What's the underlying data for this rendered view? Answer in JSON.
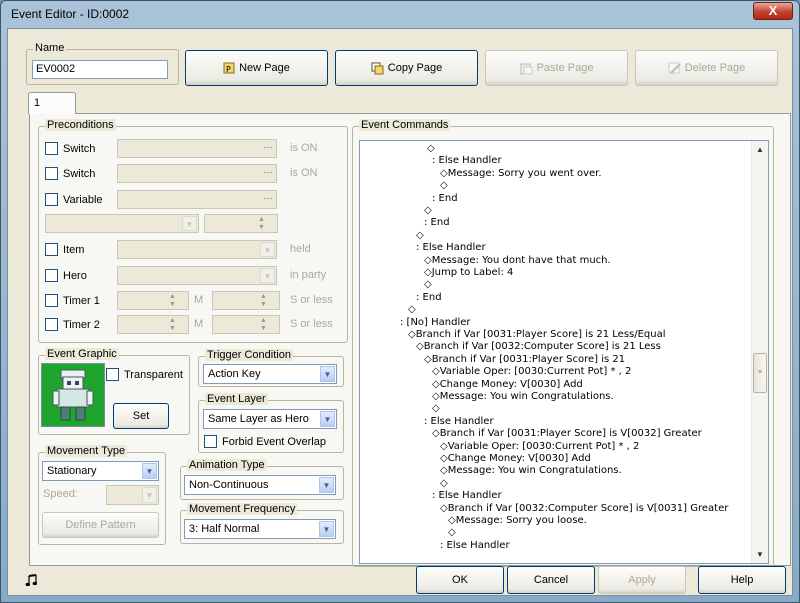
{
  "window": {
    "title": "Event Editor - ID:0002",
    "close_glyph": "X"
  },
  "name_group": {
    "label": "Name",
    "value": "EV0002"
  },
  "toolbar": {
    "new_page": "New Page",
    "copy_page": "Copy Page",
    "paste_page": "Paste Page",
    "delete_page": "Delete Page"
  },
  "tabs": [
    {
      "label": "1"
    }
  ],
  "preconditions": {
    "label": "Preconditions",
    "switch1": {
      "label": "Switch",
      "suffix": "is ON"
    },
    "switch2": {
      "label": "Switch",
      "suffix": "is ON"
    },
    "variable": {
      "label": "Variable"
    },
    "item": {
      "label": "Item",
      "suffix": "held"
    },
    "hero": {
      "label": "Hero",
      "suffix": "in party"
    },
    "timer1": {
      "label": "Timer 1",
      "unit": "M",
      "suffix": "S or less"
    },
    "timer2": {
      "label": "Timer 2",
      "unit": "M",
      "suffix": "S or less"
    }
  },
  "event_graphic": {
    "label": "Event Graphic",
    "transparent": "Transparent",
    "set": "Set"
  },
  "trigger": {
    "label": "Trigger Condition",
    "value": "Action Key"
  },
  "event_layer": {
    "label": "Event Layer",
    "value": "Same Layer as Hero",
    "forbid": "Forbid Event Overlap"
  },
  "movement_type": {
    "label": "Movement Type",
    "value": "Stationary",
    "speed": "Speed:",
    "define": "Define Pattern"
  },
  "animation": {
    "label": "Animation Type",
    "value": "Non-Continuous"
  },
  "frequency": {
    "label": "Movement Frequency",
    "value": "3: Half Normal"
  },
  "commands": {
    "label": "Event Commands",
    "lines": [
      "◇",
      ": Else Handler",
      "◇Message: Sorry you went over.",
      "◇",
      ": End",
      "◇",
      ": End",
      "◇",
      ": Else Handler",
      "◇Message: You dont have that much.",
      "◇Jump to Label: 4",
      "◇",
      ": End",
      "◇",
      ": [No] Handler",
      "◇Branch if Var [0031:Player Score] is 21 Less/Equal",
      "◇Branch if Var [0032:Computer Score] is 21 Less",
      "◇Branch if Var [0031:Player Score] is 21",
      "◇Variable Oper: [0030:Current Pot] * , 2",
      "◇Change Money: V[0030] Add",
      "◇Message: You win Congratulations.",
      "◇",
      ": Else Handler",
      "◇Branch if Var [0031:Player Score] is V[0032] Greater",
      "◇Variable Oper: [0030:Current Pot] * , 2",
      "◇Change Money: V[0030] Add",
      "◇Message: You win Congratulations.",
      "◇",
      ": Else Handler",
      "◇Branch if Var [0032:Computer Score] is V[0031] Greater",
      "◇Message: Sorry you loose.",
      "◇",
      ": Else Handler"
    ]
  },
  "footer": {
    "ok": "OK",
    "cancel": "Cancel",
    "apply": "Apply",
    "help": "Help"
  },
  "icons": {
    "new_page": "page-new-icon",
    "copy_page": "page-copy-icon",
    "paste_page": "page-paste-icon",
    "delete_page": "page-delete-icon",
    "music": "music-note-icon"
  }
}
